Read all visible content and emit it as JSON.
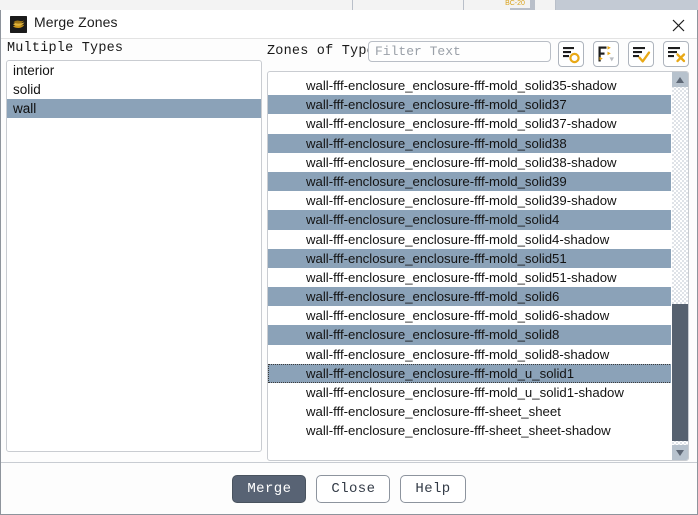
{
  "background": {
    "tab_label": "BC-20"
  },
  "dialog": {
    "title": "Merge Zones",
    "icon": "fluent-layers-icon",
    "close_icon": "close-icon"
  },
  "left_panel": {
    "label": "Multiple Types",
    "items": [
      {
        "label": "interior",
        "selected": false
      },
      {
        "label": "solid",
        "selected": false
      },
      {
        "label": "wall",
        "selected": true
      }
    ]
  },
  "right_panel": {
    "label": "Zones of Type",
    "filter": {
      "value": "",
      "placeholder": "Filter Text"
    },
    "toolbar": [
      {
        "name": "select-match-icon",
        "title": "Match"
      },
      {
        "name": "filter-options-icon",
        "title": "Filter Options"
      },
      {
        "name": "select-all-icon",
        "title": "Select All"
      },
      {
        "name": "deselect-all-icon",
        "title": "Deselect All"
      }
    ],
    "items": [
      {
        "label": "wall-fff-enclosure_enclosure-fff-mold_solid35-shadow",
        "selected": false,
        "focus": false
      },
      {
        "label": "wall-fff-enclosure_enclosure-fff-mold_solid37",
        "selected": true,
        "focus": false
      },
      {
        "label": "wall-fff-enclosure_enclosure-fff-mold_solid37-shadow",
        "selected": false,
        "focus": false
      },
      {
        "label": "wall-fff-enclosure_enclosure-fff-mold_solid38",
        "selected": true,
        "focus": false
      },
      {
        "label": "wall-fff-enclosure_enclosure-fff-mold_solid38-shadow",
        "selected": false,
        "focus": false
      },
      {
        "label": "wall-fff-enclosure_enclosure-fff-mold_solid39",
        "selected": true,
        "focus": false
      },
      {
        "label": "wall-fff-enclosure_enclosure-fff-mold_solid39-shadow",
        "selected": false,
        "focus": false
      },
      {
        "label": "wall-fff-enclosure_enclosure-fff-mold_solid4",
        "selected": true,
        "focus": false
      },
      {
        "label": "wall-fff-enclosure_enclosure-fff-mold_solid4-shadow",
        "selected": false,
        "focus": false
      },
      {
        "label": "wall-fff-enclosure_enclosure-fff-mold_solid51",
        "selected": true,
        "focus": false
      },
      {
        "label": "wall-fff-enclosure_enclosure-fff-mold_solid51-shadow",
        "selected": false,
        "focus": false
      },
      {
        "label": "wall-fff-enclosure_enclosure-fff-mold_solid6",
        "selected": true,
        "focus": false
      },
      {
        "label": "wall-fff-enclosure_enclosure-fff-mold_solid6-shadow",
        "selected": false,
        "focus": false
      },
      {
        "label": "wall-fff-enclosure_enclosure-fff-mold_solid8",
        "selected": true,
        "focus": false
      },
      {
        "label": "wall-fff-enclosure_enclosure-fff-mold_solid8-shadow",
        "selected": false,
        "focus": false
      },
      {
        "label": "wall-fff-enclosure_enclosure-fff-mold_u_solid1",
        "selected": true,
        "focus": true
      },
      {
        "label": "wall-fff-enclosure_enclosure-fff-mold_u_solid1-shadow",
        "selected": false,
        "focus": false
      },
      {
        "label": "wall-fff-enclosure_enclosure-fff-sheet_sheet",
        "selected": false,
        "focus": false
      },
      {
        "label": "wall-fff-enclosure_enclosure-fff-sheet_sheet-shadow",
        "selected": false,
        "focus": false
      }
    ],
    "scrollbar": {
      "up_arrow": "triangle-up-icon",
      "down_arrow": "triangle-down-icon"
    }
  },
  "footer": {
    "buttons": [
      {
        "label": "Merge",
        "style": "default"
      },
      {
        "label": "Close",
        "style": "normal"
      },
      {
        "label": "Help",
        "style": "normal"
      }
    ]
  },
  "colors": {
    "selection": "#8ba2b8",
    "default_button": "#586374",
    "accent_gold": "#e9a916",
    "scroll_thumb": "#56616f"
  }
}
